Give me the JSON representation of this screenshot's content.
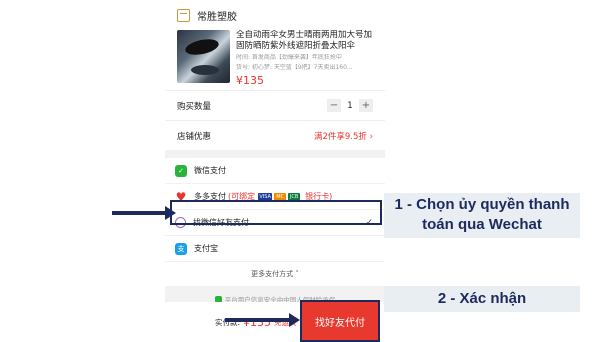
{
  "shop": {
    "name": "常胜塑胶"
  },
  "product": {
    "title": "全自动雨伞女男士晴雨两用加大号加固防晒防紫外线遮阳折叠太阳伞",
    "sub1": "时间: 首发商品【劲爆来袭】年底狂抢中",
    "sub2": "货号: 初心梦: 天空蓝【9把】7天卖出160...",
    "price": "¥135"
  },
  "quantity": {
    "label": "购买数量",
    "minus": "−",
    "value": "1",
    "plus": "+"
  },
  "promo": {
    "label": "店铺优惠",
    "value": "满2件享9.5折 ›"
  },
  "payments": [
    {
      "label": "微信支付",
      "icon": "wechat-pay-icon"
    },
    {
      "label": "多多支付",
      "bind": "(可绑定",
      "cards_suffix": "银行卡)",
      "icon": "duoduo-heart-icon"
    },
    {
      "label": "找微信好友支付",
      "icon": "friend-icon",
      "selected": true
    },
    {
      "label": "支付宝",
      "icon": "alipay-icon"
    }
  ],
  "card_logos": [
    "VISA",
    "MC",
    "JCB"
  ],
  "more_payments": "更多支付方式 ˅",
  "notice": "平台用户信息安全由中国人保财险承保",
  "bottom": {
    "total_label": "实付款:",
    "total": "¥135",
    "shipping": "免运费",
    "button": "找好友代付"
  },
  "annotations": {
    "step1": "1 - Chọn ủy quyền thanh toán qua Wechat",
    "step2": "2 - Xác nhận"
  },
  "colors": {
    "accent": "#e8352e",
    "annotation": "#1c2a5e",
    "wechat": "#29b33b",
    "alipay": "#1a9fe8"
  }
}
